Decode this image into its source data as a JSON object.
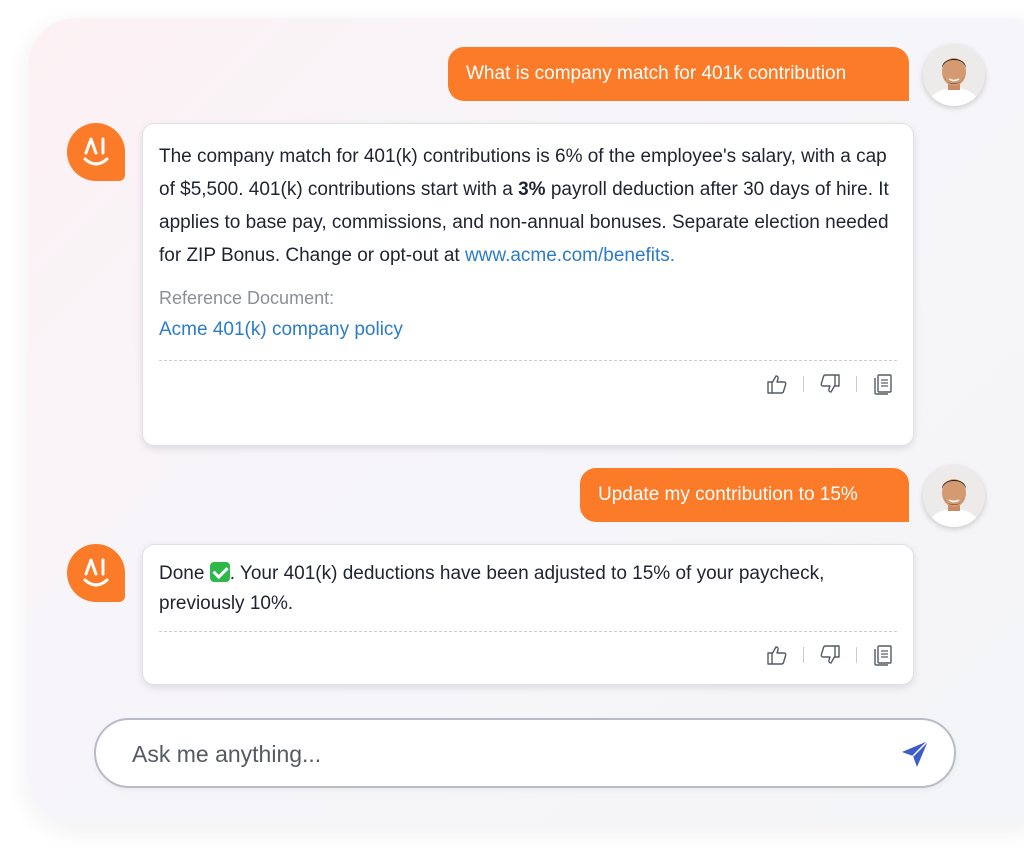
{
  "messages": [
    {
      "role": "user",
      "text": "What is company match for 401k contribution"
    },
    {
      "role": "assistant",
      "text_part1": "The company match for 401(k) contributions is 6% of the employee's salary, with a cap of $5,500. 401(k) contributions start with a ",
      "text_bold": "3%",
      "text_part2": " payroll deduction after 30 days of hire. It applies to base pay, commissions, and non-annual bonuses. Separate election needed for ZIP Bonus. Change or opt-out at ",
      "link_text": "www.acme.com/benefits.",
      "reference_label": "Reference Document:",
      "reference_link": "Acme 401(k) company policy"
    },
    {
      "role": "user",
      "text": "Update my contribution to 15%"
    },
    {
      "role": "assistant",
      "text_prefix": "Done ",
      "text_suffix": ". Your 401(k) deductions have been adjusted to 15% of your paycheck, previously 10%."
    }
  ],
  "icons": {
    "ai_logo": "ai-smile-logo",
    "thumbs_up": "thumbs-up-icon",
    "thumbs_down": "thumbs-down-icon",
    "copy": "copy-icon",
    "send": "send-icon",
    "check": "check-mark-emoji"
  },
  "input": {
    "placeholder": "Ask me anything..."
  },
  "colors": {
    "accent": "#fb7b28",
    "link": "#2c7cc6",
    "send_icon": "#3e5bc7"
  }
}
